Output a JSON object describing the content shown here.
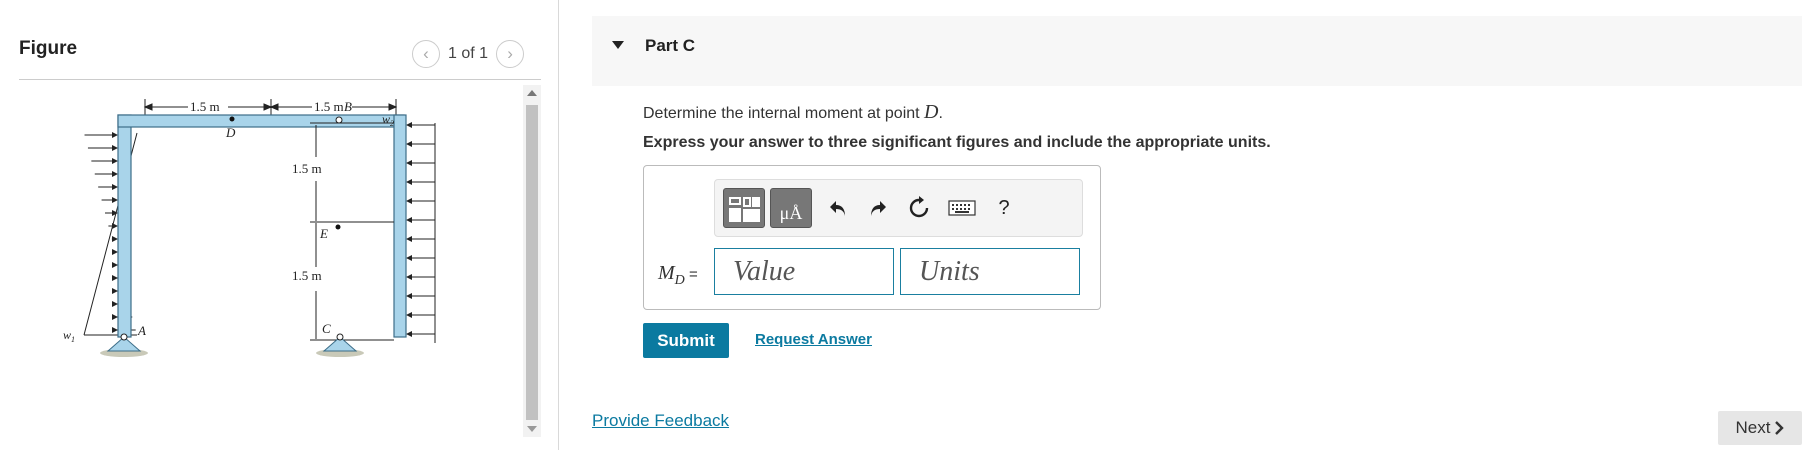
{
  "figure": {
    "title": "Figure",
    "pager": {
      "text": "1 of 1",
      "prev_icon": "chevron-left-icon",
      "next_icon": "chevron-right-icon"
    },
    "labels": {
      "dim_left": "1.5 m",
      "dim_right": "1.5 m",
      "dim_upper": "1.5 m",
      "dim_lower": "1.5 m",
      "B": "B",
      "D": "D",
      "E": "E",
      "C": "C",
      "A": "A",
      "w1": "w",
      "w1_sub": "1",
      "w2": "w",
      "w2_sub": "2"
    }
  },
  "part": {
    "title": "Part C",
    "question_text": "Determine the internal moment at point ",
    "question_var": "D",
    "question_end": ".",
    "instruction": "Express your answer to three significant figures and include the appropriate units.",
    "toolbar": {
      "templates_icon": "templates-icon",
      "units_label": "μÅ",
      "undo_icon": "undo-icon",
      "redo_icon": "redo-icon",
      "reset_icon": "reset-icon",
      "keyboard_icon": "keyboard-icon",
      "help_label": "?"
    },
    "answer": {
      "label_main": "M",
      "label_sub": "D",
      "label_eq": " =",
      "value_placeholder": "Value",
      "units_placeholder": "Units"
    },
    "submit_label": "Submit",
    "request_label": "Request Answer"
  },
  "footer": {
    "feedback_label": "Provide Feedback",
    "next_label": "Next"
  },
  "colors": {
    "accent": "#0b7aa0",
    "member_fill": "#a9d4ea",
    "member_stroke": "#3c6d88"
  }
}
